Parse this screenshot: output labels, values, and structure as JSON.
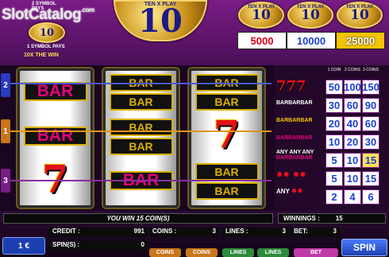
{
  "logo": {
    "text": "SlotCatalog",
    "suffix": ".com"
  },
  "top": {
    "main_coin": "10",
    "ring_text": "TEN X PLAY",
    "small_coin_label": "TEN X PLAY",
    "small_coins": [
      "10",
      "10",
      "10"
    ],
    "pay_2": "2 SYMBOL PAYS",
    "pay_1": "1 SYMBOL PAYS",
    "pay_10x": "10X THE WIN",
    "jackpots": [
      "5000",
      "10000",
      "25000"
    ],
    "jackpot_colors": [
      "#d9001b",
      "#1c3fd0",
      "#f5c400"
    ]
  },
  "reels": [
    [
      "BAR",
      "BAR",
      "7"
    ],
    [
      "BAR BAR",
      "BAR BAR",
      "BAR"
    ],
    [
      "BAR BAR",
      "7",
      "BAR BAR"
    ]
  ],
  "lines": [
    "2",
    "1",
    "3"
  ],
  "paytable": {
    "headers": [
      "1 COIN",
      "2 COINS",
      "3 COINS"
    ],
    "rows": [
      {
        "symbol": "777",
        "values": [
          "50",
          "100",
          "150"
        ]
      },
      {
        "symbol": "BARBARBAR",
        "values": [
          "30",
          "60",
          "90"
        ]
      },
      {
        "symbol": "BARBARBAR",
        "values": [
          "20",
          "40",
          "60"
        ]
      },
      {
        "symbol": "BARBARBAR",
        "values": [
          "10",
          "20",
          "30"
        ]
      },
      {
        "symbol": "ANY ANY ANY",
        "values": [
          "5",
          "10",
          "15"
        ]
      },
      {
        "symbol": "cherries",
        "values": [
          "5",
          "10",
          "15"
        ]
      },
      {
        "symbol": "ANY",
        "values": [
          "2",
          "4",
          "6"
        ]
      }
    ]
  },
  "status": {
    "message": "YOU WIN 15 COIN(S)",
    "winnings_label": "WINNINGS :",
    "winnings": "15",
    "coin_value": "1 €",
    "credit_label": "CREDIT :",
    "credit": "991",
    "coins_label": "COINS :",
    "coins": "3",
    "lines_label": "LINES :",
    "lines": "3",
    "bet_label": "BET:",
    "bet": "3",
    "spins_label": "SPIN(S) :",
    "spins": "0"
  },
  "buttons": {
    "coins_minus": "COINS",
    "coins_plus": "COINS",
    "lines_minus": "LINES",
    "lines_plus": "LINES",
    "bet": "BET",
    "spin": "SPIN"
  }
}
